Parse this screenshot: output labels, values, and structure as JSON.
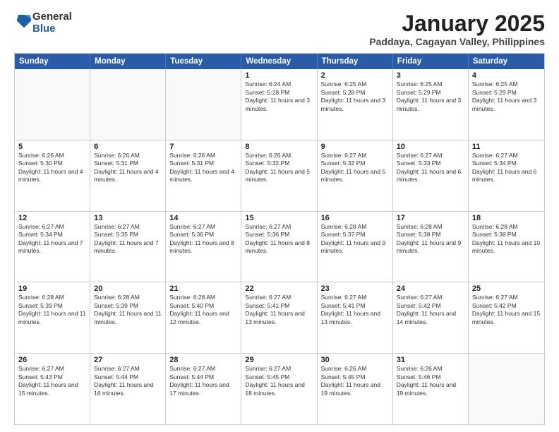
{
  "logo": {
    "general": "General",
    "blue": "Blue"
  },
  "header": {
    "month": "January 2025",
    "location": "Paddaya, Cagayan Valley, Philippines"
  },
  "weekdays": [
    "Sunday",
    "Monday",
    "Tuesday",
    "Wednesday",
    "Thursday",
    "Friday",
    "Saturday"
  ],
  "rows": [
    [
      {
        "day": "",
        "empty": true
      },
      {
        "day": "",
        "empty": true
      },
      {
        "day": "",
        "empty": true
      },
      {
        "day": "1",
        "sunrise": "Sunrise: 6:24 AM",
        "sunset": "Sunset: 5:28 PM",
        "daylight": "Daylight: 11 hours and 3 minutes."
      },
      {
        "day": "2",
        "sunrise": "Sunrise: 6:25 AM",
        "sunset": "Sunset: 5:28 PM",
        "daylight": "Daylight: 11 hours and 3 minutes."
      },
      {
        "day": "3",
        "sunrise": "Sunrise: 6:25 AM",
        "sunset": "Sunset: 5:29 PM",
        "daylight": "Daylight: 11 hours and 3 minutes."
      },
      {
        "day": "4",
        "sunrise": "Sunrise: 6:25 AM",
        "sunset": "Sunset: 5:29 PM",
        "daylight": "Daylight: 11 hours and 3 minutes."
      }
    ],
    [
      {
        "day": "5",
        "sunrise": "Sunrise: 6:26 AM",
        "sunset": "Sunset: 5:30 PM",
        "daylight": "Daylight: 11 hours and 4 minutes."
      },
      {
        "day": "6",
        "sunrise": "Sunrise: 6:26 AM",
        "sunset": "Sunset: 5:31 PM",
        "daylight": "Daylight: 11 hours and 4 minutes."
      },
      {
        "day": "7",
        "sunrise": "Sunrise: 6:26 AM",
        "sunset": "Sunset: 5:31 PM",
        "daylight": "Daylight: 11 hours and 4 minutes."
      },
      {
        "day": "8",
        "sunrise": "Sunrise: 6:26 AM",
        "sunset": "Sunset: 5:32 PM",
        "daylight": "Daylight: 11 hours and 5 minutes."
      },
      {
        "day": "9",
        "sunrise": "Sunrise: 6:27 AM",
        "sunset": "Sunset: 5:32 PM",
        "daylight": "Daylight: 11 hours and 5 minutes."
      },
      {
        "day": "10",
        "sunrise": "Sunrise: 6:27 AM",
        "sunset": "Sunset: 5:33 PM",
        "daylight": "Daylight: 11 hours and 6 minutes."
      },
      {
        "day": "11",
        "sunrise": "Sunrise: 6:27 AM",
        "sunset": "Sunset: 5:34 PM",
        "daylight": "Daylight: 11 hours and 6 minutes."
      }
    ],
    [
      {
        "day": "12",
        "sunrise": "Sunrise: 6:27 AM",
        "sunset": "Sunset: 5:34 PM",
        "daylight": "Daylight: 11 hours and 7 minutes."
      },
      {
        "day": "13",
        "sunrise": "Sunrise: 6:27 AM",
        "sunset": "Sunset: 5:35 PM",
        "daylight": "Daylight: 11 hours and 7 minutes."
      },
      {
        "day": "14",
        "sunrise": "Sunrise: 6:27 AM",
        "sunset": "Sunset: 5:36 PM",
        "daylight": "Daylight: 11 hours and 8 minutes."
      },
      {
        "day": "15",
        "sunrise": "Sunrise: 6:27 AM",
        "sunset": "Sunset: 5:36 PM",
        "daylight": "Daylight: 11 hours and 8 minutes."
      },
      {
        "day": "16",
        "sunrise": "Sunrise: 6:28 AM",
        "sunset": "Sunset: 5:37 PM",
        "daylight": "Daylight: 11 hours and 9 minutes."
      },
      {
        "day": "17",
        "sunrise": "Sunrise: 6:28 AM",
        "sunset": "Sunset: 5:38 PM",
        "daylight": "Daylight: 11 hours and 9 minutes."
      },
      {
        "day": "18",
        "sunrise": "Sunrise: 6:28 AM",
        "sunset": "Sunset: 5:38 PM",
        "daylight": "Daylight: 11 hours and 10 minutes."
      }
    ],
    [
      {
        "day": "19",
        "sunrise": "Sunrise: 6:28 AM",
        "sunset": "Sunset: 5:39 PM",
        "daylight": "Daylight: 11 hours and 11 minutes."
      },
      {
        "day": "20",
        "sunrise": "Sunrise: 6:28 AM",
        "sunset": "Sunset: 5:39 PM",
        "daylight": "Daylight: 11 hours and 11 minutes."
      },
      {
        "day": "21",
        "sunrise": "Sunrise: 6:28 AM",
        "sunset": "Sunset: 5:40 PM",
        "daylight": "Daylight: 11 hours and 12 minutes."
      },
      {
        "day": "22",
        "sunrise": "Sunrise: 6:27 AM",
        "sunset": "Sunset: 5:41 PM",
        "daylight": "Daylight: 11 hours and 13 minutes."
      },
      {
        "day": "23",
        "sunrise": "Sunrise: 6:27 AM",
        "sunset": "Sunset: 5:41 PM",
        "daylight": "Daylight: 11 hours and 13 minutes."
      },
      {
        "day": "24",
        "sunrise": "Sunrise: 6:27 AM",
        "sunset": "Sunset: 5:42 PM",
        "daylight": "Daylight: 11 hours and 14 minutes."
      },
      {
        "day": "25",
        "sunrise": "Sunrise: 6:27 AM",
        "sunset": "Sunset: 5:42 PM",
        "daylight": "Daylight: 11 hours and 15 minutes."
      }
    ],
    [
      {
        "day": "26",
        "sunrise": "Sunrise: 6:27 AM",
        "sunset": "Sunset: 5:43 PM",
        "daylight": "Daylight: 11 hours and 15 minutes."
      },
      {
        "day": "27",
        "sunrise": "Sunrise: 6:27 AM",
        "sunset": "Sunset: 5:44 PM",
        "daylight": "Daylight: 11 hours and 16 minutes."
      },
      {
        "day": "28",
        "sunrise": "Sunrise: 6:27 AM",
        "sunset": "Sunset: 5:44 PM",
        "daylight": "Daylight: 11 hours and 17 minutes."
      },
      {
        "day": "29",
        "sunrise": "Sunrise: 6:27 AM",
        "sunset": "Sunset: 5:45 PM",
        "daylight": "Daylight: 11 hours and 18 minutes."
      },
      {
        "day": "30",
        "sunrise": "Sunrise: 6:26 AM",
        "sunset": "Sunset: 5:45 PM",
        "daylight": "Daylight: 11 hours and 19 minutes."
      },
      {
        "day": "31",
        "sunrise": "Sunrise: 6:26 AM",
        "sunset": "Sunset: 5:46 PM",
        "daylight": "Daylight: 11 hours and 19 minutes."
      },
      {
        "day": "",
        "empty": true
      }
    ]
  ]
}
